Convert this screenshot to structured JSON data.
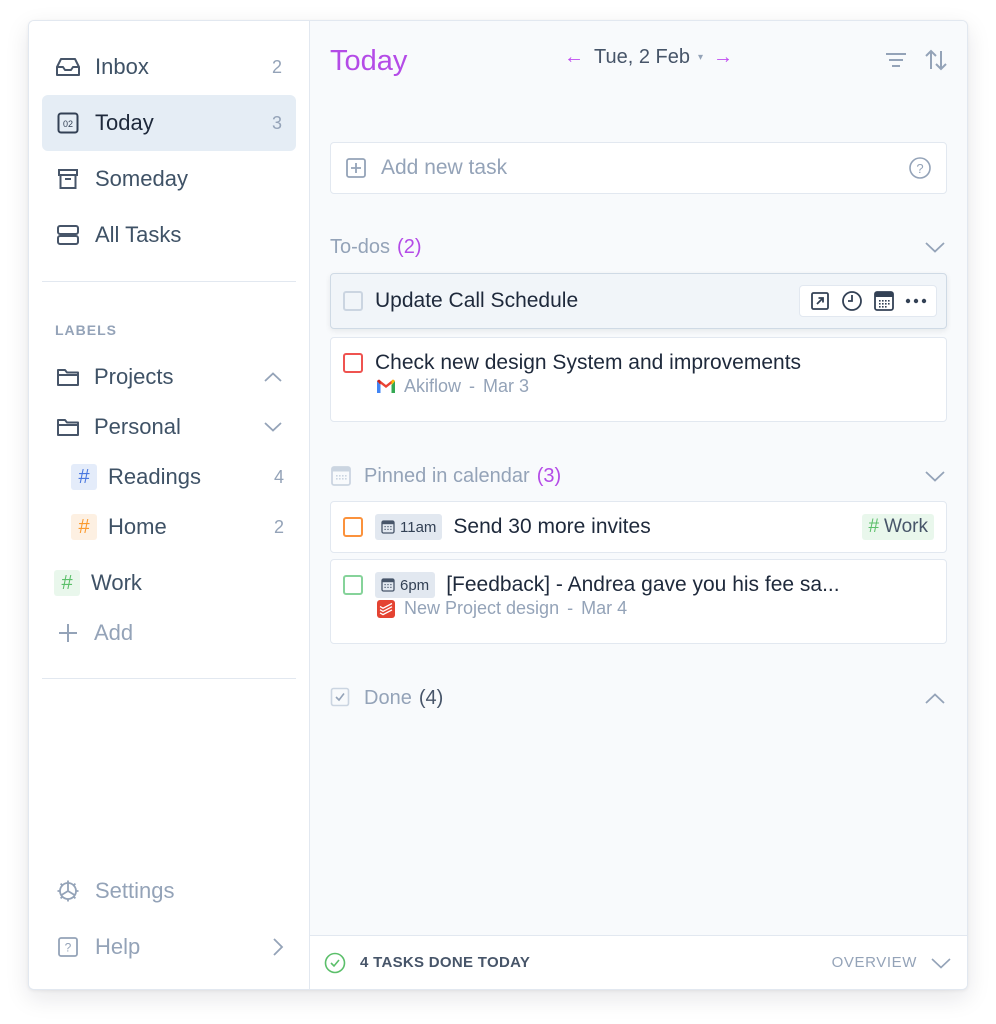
{
  "sidebar": {
    "nav": [
      {
        "id": "inbox",
        "label": "Inbox",
        "count": "2",
        "icon": "inbox-icon"
      },
      {
        "id": "today",
        "label": "Today",
        "count": "3",
        "icon": "calendar-day-icon",
        "icon_text": "02",
        "active": true
      },
      {
        "id": "someday",
        "label": "Someday",
        "count": "",
        "icon": "archive-box-icon"
      },
      {
        "id": "all-tasks",
        "label": "All Tasks",
        "count": "",
        "icon": "stack-icon"
      }
    ],
    "labels_title": "LABELS",
    "labels": [
      {
        "label": "Projects",
        "icon": "folder-icon",
        "chevron": "up"
      },
      {
        "label": "Personal",
        "icon": "folder-icon",
        "chevron": "down"
      },
      {
        "label": "Readings",
        "count": "4",
        "hash_color": "#4a78e0",
        "hash_bg": "#e4ecfa"
      },
      {
        "label": "Home",
        "count": "2",
        "hash_color": "#fb9a2e",
        "hash_bg": "#fdf0e2"
      },
      {
        "label": "Work",
        "hash_color": "#5bbf6a",
        "hash_bg": "#e9f7ec"
      }
    ],
    "add_label": "Add",
    "bottom": [
      {
        "label": "Settings",
        "icon": "gear-icon"
      },
      {
        "label": "Help",
        "icon": "help-icon"
      }
    ]
  },
  "header": {
    "title": "Today",
    "date": "Tue, 2 Feb",
    "prev": "←",
    "next": "→",
    "caret": "▾"
  },
  "add_task": {
    "placeholder": "Add new task"
  },
  "sections": {
    "todos": {
      "title": "To-dos",
      "count": "(2)"
    },
    "pinned": {
      "title": "Pinned in calendar",
      "count": "(3)"
    },
    "done": {
      "title": "Done",
      "count": "(4)"
    }
  },
  "tasks": {
    "todo1": {
      "title": "Update Call Schedule"
    },
    "todo2": {
      "title": "Check new design System and improvements",
      "source": "Akiflow",
      "date": "Mar 3",
      "sep": "-"
    },
    "pinned1": {
      "time": "11am",
      "title": "Send 30 more invites",
      "tag": "Work",
      "tag_hash": "#"
    },
    "pinned2": {
      "time": "6pm",
      "title": "[Feedback] - Andrea gave you his fee sa...",
      "source": "New Project design",
      "date": "Mar 4",
      "sep": "-"
    }
  },
  "footer": {
    "done_text": "4 TASKS DONE TODAY",
    "overview": "OVERVIEW"
  },
  "colors": {
    "accent": "#b44be7",
    "sidebar_active": "#e5edf5",
    "success": "#5bbf6a"
  }
}
